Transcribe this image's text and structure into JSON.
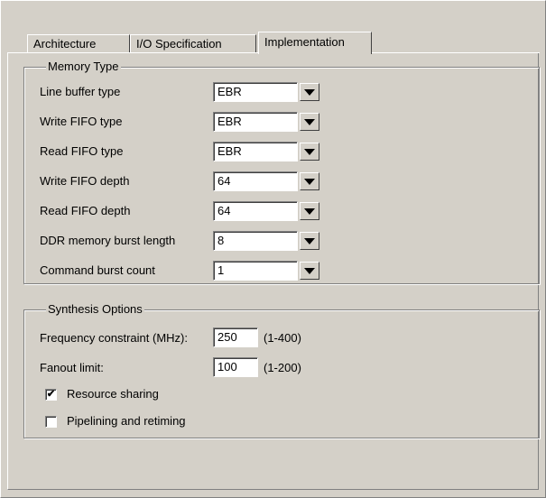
{
  "tabs": {
    "architecture": "Architecture",
    "io_spec": "I/O Specification",
    "implementation": "Implementation"
  },
  "memory_type": {
    "title": "Memory Type",
    "rows": [
      {
        "label": "Line buffer type",
        "value": "EBR"
      },
      {
        "label": "Write FIFO type",
        "value": "EBR"
      },
      {
        "label": "Read FIFO type",
        "value": "EBR"
      },
      {
        "label": "Write FIFO depth",
        "value": "64"
      },
      {
        "label": "Read FIFO depth",
        "value": "64"
      },
      {
        "label": "DDR memory burst length",
        "value": "8"
      },
      {
        "label": "Command burst count",
        "value": "1"
      }
    ]
  },
  "synthesis": {
    "title": "Synthesis Options",
    "freq_label": "Frequency constraint (MHz):",
    "freq_value": "250",
    "freq_range": "(1-400)",
    "fanout_label": "Fanout limit:",
    "fanout_value": "100",
    "fanout_range": "(1-200)",
    "resource_sharing_label": "Resource sharing",
    "resource_sharing_checked": true,
    "resource_sharing_mark": "✔",
    "pipelining_label": "Pipelining and retiming",
    "pipelining_checked": false
  }
}
